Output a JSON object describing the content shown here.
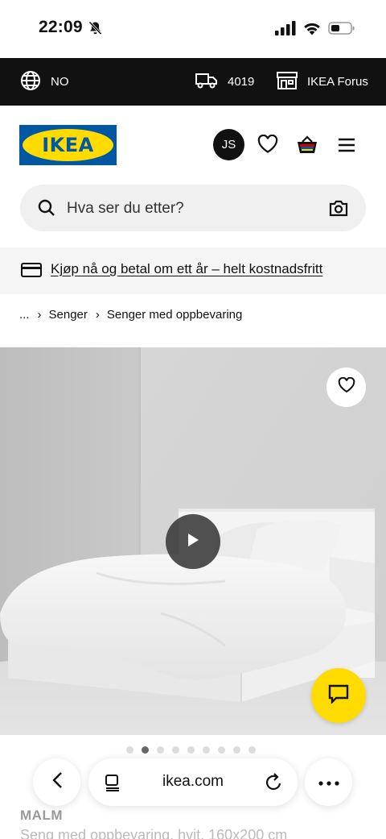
{
  "status_bar": {
    "time": "22:09",
    "icons": [
      "bell-slash-icon",
      "cellular-signal-icon",
      "wifi-icon",
      "battery-icon"
    ]
  },
  "topbar": {
    "language": "NO",
    "postal_code": "4019",
    "store": "IKEA Forus",
    "icons": [
      "globe-icon",
      "delivery-truck-icon",
      "store-icon"
    ]
  },
  "header": {
    "logo_text": "IKEA",
    "avatar_initials": "JS",
    "icons": [
      "heart-icon",
      "shopping-bag-icon",
      "menu-icon"
    ]
  },
  "search": {
    "placeholder": "Hva ser du etter?",
    "icons": [
      "search-icon",
      "camera-icon"
    ]
  },
  "promo": {
    "text": "Kjøp nå og betal om ett år – helt kostnadsfritt",
    "icon": "credit-card-icon"
  },
  "breadcrumb": {
    "items": [
      "...",
      "Senger",
      "Senger med oppbevaring"
    ],
    "separator": "›"
  },
  "product": {
    "image_icons": [
      "heart-icon",
      "play-icon"
    ],
    "carousel": {
      "total": 9,
      "active_index": 1
    },
    "brand": "MALM",
    "description": "Seng med oppbevaring, hvit, 160x200 cm"
  },
  "chat": {
    "icon": "chat-icon",
    "color": "#ffdb00"
  },
  "browser": {
    "url": "ikea.com",
    "icons": [
      "chevron-left-icon",
      "tab-menu-icon",
      "reload-icon",
      "more-icon"
    ]
  },
  "colors": {
    "ikea_blue": "#0058a3",
    "ikea_yellow": "#ffdb00",
    "topbar_bg": "#111111"
  }
}
